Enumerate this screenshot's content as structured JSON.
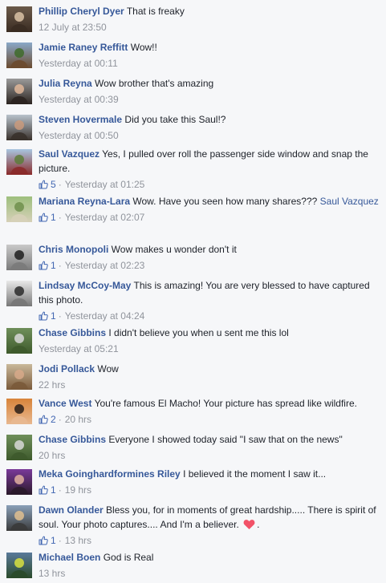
{
  "comments": [
    {
      "author": "Phillip Cheryl Dyer",
      "text": "That is freaky",
      "time": "12 July at 23:50",
      "likes": "",
      "avatar": "photo-couple-icon",
      "palette": [
        "#6b5a4a",
        "#d9c2a6",
        "#3a2c22"
      ]
    },
    {
      "author": "Jamie Raney Reffitt",
      "text": "Wow!!",
      "time": "Yesterday at 00:11",
      "likes": "",
      "avatar": "photo-farm-icon",
      "palette": [
        "#8aa8c8",
        "#3f6b2a",
        "#6b4a2e"
      ]
    },
    {
      "author": "Julia Reyna",
      "text": "Wow brother that's amazing",
      "time": "Yesterday at 00:39",
      "likes": "",
      "avatar": "photo-woman-icon",
      "palette": [
        "#9a9a9a",
        "#e0b79a",
        "#2b2420"
      ]
    },
    {
      "author": "Steven Hovermale",
      "text": "Did you take this Saul!?",
      "time": "Yesterday at 00:50",
      "likes": "",
      "avatar": "photo-man-icon",
      "palette": [
        "#b8c2cc",
        "#c99a7c",
        "#39312b"
      ]
    },
    {
      "author": "Saul Vazquez",
      "text": "Yes, I pulled over roll the passenger side window and snap the picture.",
      "time": "Yesterday at 01:25",
      "likes": "5",
      "avatar": "photo-car-icon",
      "palette": [
        "#a9c6e0",
        "#5d7c3a",
        "#8a2a2a"
      ]
    },
    {
      "author": "Mariana Reyna-Lara",
      "text": "Wow. Have you seen how many shares???",
      "mention": "Saul Vazquez",
      "time": "Yesterday at 02:07",
      "likes": "1",
      "avatar": "photo-path-icon",
      "palette": [
        "#9dbf7d",
        "#6e8f4c",
        "#d6d0b8"
      ]
    },
    {
      "author": "Chris Monopoli",
      "text": "Wow makes u wonder don't it",
      "time": "Yesterday at 02:23",
      "likes": "1",
      "avatar": "photo-motorcycle-icon",
      "palette": [
        "#c9c9c9",
        "#1f1f1f",
        "#7a7a7a"
      ]
    },
    {
      "author": "Lindsay McCoy-May",
      "text": "This is amazing! You are very blessed to have captured this photo.",
      "time": "Yesterday at 04:24",
      "likes": "1",
      "avatar": "photo-bw-portrait-icon",
      "palette": [
        "#e8e8e8",
        "#2a2a2a",
        "#777777"
      ]
    },
    {
      "author": "Chase Gibbins",
      "text": "I didn't believe you when u sent me this lol",
      "time": "Yesterday at 05:21",
      "likes": "",
      "avatar": "photo-truck-icon",
      "palette": [
        "#6f8f5a",
        "#d8d8d8",
        "#3e5a2c"
      ]
    },
    {
      "author": "Jodi Pollack",
      "text": "Wow",
      "time": "22 hrs",
      "likes": "",
      "avatar": "photo-woman-glasses-icon",
      "palette": [
        "#c9b89a",
        "#d7a98a",
        "#7a5a3a"
      ]
    },
    {
      "author": "Vance West",
      "text": "You're famous El Macho! Your picture has spread like wildfire.",
      "time": "20 hrs",
      "likes": "2",
      "avatar": "photo-couple-sunset-icon",
      "palette": [
        "#d8843a",
        "#2a1e18",
        "#e8b890"
      ]
    },
    {
      "author": "Chase Gibbins",
      "text": "Everyone I showed today said \"I saw that on the news\"",
      "time": "20 hrs",
      "likes": "",
      "avatar": "photo-truck-icon",
      "palette": [
        "#6f8f5a",
        "#d8d8d8",
        "#3e5a2c"
      ]
    },
    {
      "author": "Meka Goinghardformines Riley",
      "text": "I believed it the moment I saw it...",
      "time": "19 hrs",
      "likes": "1",
      "avatar": "photo-purple-portrait-icon",
      "palette": [
        "#7a3a9a",
        "#e0b0a0",
        "#2a1a2a"
      ]
    },
    {
      "author": "Dawn Olander",
      "text": "Bless you, for in moments of great hardship..... There is spirit of soul. Your photo captures.... And I'm a believer.",
      "heart": true,
      "tail": ".",
      "time": "13 hrs",
      "likes": "1",
      "avatar": "photo-sunglasses-icon",
      "palette": [
        "#8aa0b8",
        "#e0c090",
        "#3a3a3a"
      ]
    },
    {
      "author": "Michael Boen",
      "text": "God is Real",
      "time": "13 hrs",
      "likes": "",
      "avatar": "photo-runner-icon",
      "palette": [
        "#5a7a9a",
        "#d8e040",
        "#2a4a2a"
      ]
    }
  ],
  "colors": {
    "author": "#365899",
    "meta": "#90949c",
    "like": "#4267b2",
    "heart": "#f25268",
    "background": "#f6f7f9"
  }
}
